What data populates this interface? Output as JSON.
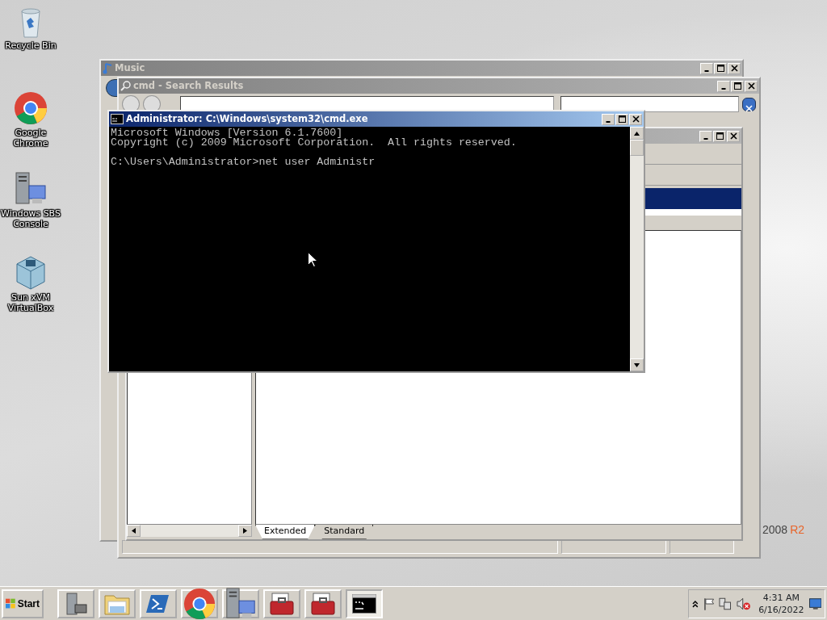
{
  "desktop_icons": [
    {
      "kind": "recycle",
      "label": "Recycle Bin"
    },
    {
      "kind": "chrome",
      "label": "Google Chrome"
    },
    {
      "kind": "server",
      "label": "Windows SBS Console"
    },
    {
      "kind": "cube",
      "label": "Sun xVM VirtualBox"
    }
  ],
  "wallpaper": {
    "brand_year": "2008",
    "brand_edition": "R2"
  },
  "music_window": {
    "title": "Music"
  },
  "search_window": {
    "title": "cmd - Search Results"
  },
  "console_window": {
    "tabs": [
      {
        "label": "Extended",
        "selected": true
      },
      {
        "label": "Standard",
        "selected": false
      }
    ]
  },
  "cmd_window": {
    "title": "Administrator: C:\\Windows\\system32\\cmd.exe",
    "blocks": [
      [
        "Microsoft Windows [Version 6.1.7600]",
        "Copyright (c) 2009 Microsoft Corporation.  All rights reserved."
      ],
      [
        "C:\\Users\\Administrator>net user Administr"
      ]
    ]
  },
  "taskbar": {
    "start_label": "Start",
    "items": [
      {
        "kind": "server-tools",
        "selected": false
      },
      {
        "kind": "folder",
        "selected": false
      },
      {
        "kind": "shell",
        "selected": false
      },
      {
        "kind": "chrome",
        "selected": false
      },
      {
        "kind": "server",
        "selected": false
      },
      {
        "kind": "toolbox",
        "selected": false
      },
      {
        "kind": "toolbox",
        "selected": false
      },
      {
        "kind": "terminal",
        "selected": true
      }
    ],
    "clock": {
      "time": "4:31 AM",
      "date": "6/16/2022"
    }
  }
}
